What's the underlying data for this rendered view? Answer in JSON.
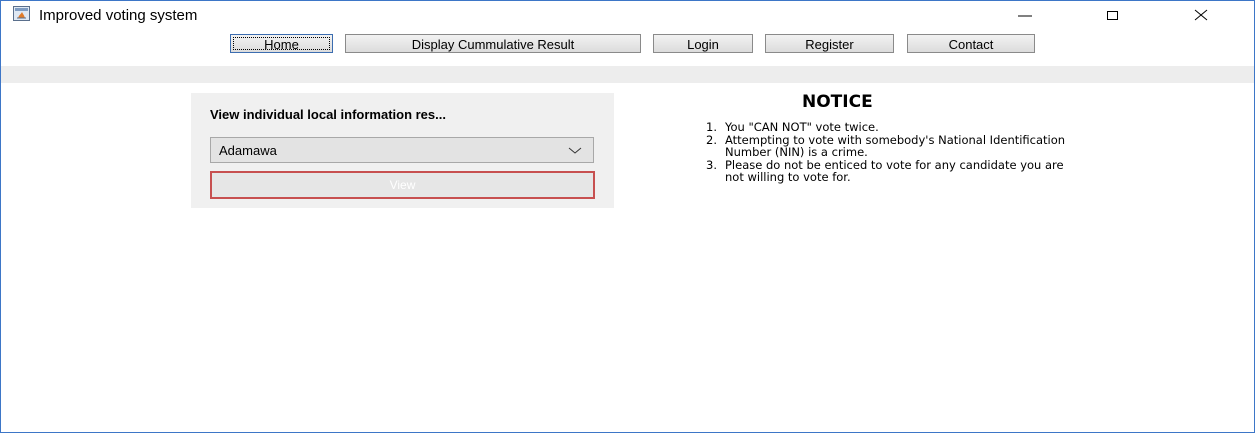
{
  "window": {
    "title": "Improved voting system",
    "controls": {
      "minimize": "minimize-icon",
      "maximize": "maximize-icon",
      "close": "close-icon"
    }
  },
  "menu": {
    "home": "Home",
    "display": "Display Cummulative Result",
    "login": "Login",
    "register": "Register",
    "contact": "Contact"
  },
  "panel": {
    "title": "View individual local information res...",
    "state_selected": "Adamawa",
    "view_label": "View"
  },
  "notice": {
    "title": "NOTICE",
    "items": [
      {
        "num": "1.",
        "text": "You \"CAN NOT\" vote twice."
      },
      {
        "num": "2.",
        "text": "Attempting to vote with somebody's National Identification Number (NIN) is a crime."
      },
      {
        "num": "3.",
        "text": "Please do not be enticed to vote for any candidate you are not willing to vote for."
      }
    ]
  },
  "colors": {
    "window_border": "#3d76c7",
    "view_border": "#c75050",
    "panel_bg": "#f0f0f0"
  }
}
